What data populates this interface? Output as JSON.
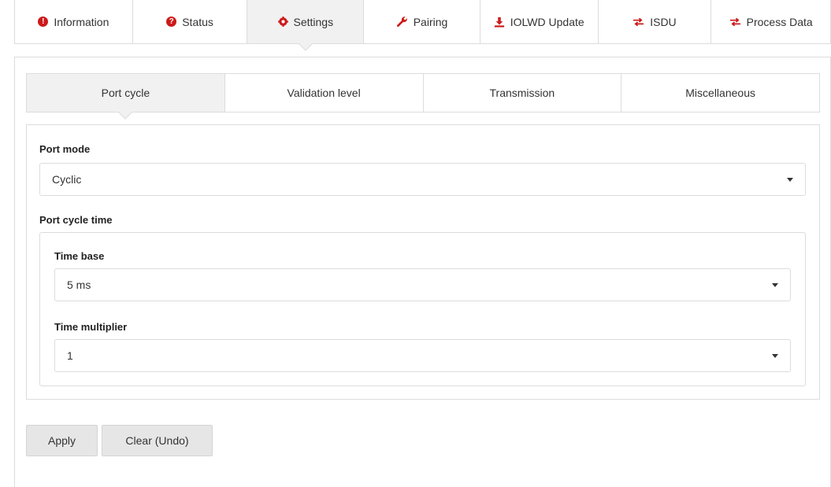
{
  "top_tabs": [
    {
      "label": "Information",
      "icon": "info-icon"
    },
    {
      "label": "Status",
      "icon": "help-icon"
    },
    {
      "label": "Settings",
      "icon": "gear-icon"
    },
    {
      "label": "Pairing",
      "icon": "wrench-icon"
    },
    {
      "label": "IOLWD Update",
      "icon": "download-icon"
    },
    {
      "label": "ISDU",
      "icon": "exchange-icon"
    },
    {
      "label": "Process Data",
      "icon": "exchange-icon"
    }
  ],
  "active_top_tab": "Settings",
  "sub_tabs": [
    {
      "label": "Port cycle"
    },
    {
      "label": "Validation level"
    },
    {
      "label": "Transmission"
    },
    {
      "label": "Miscellaneous"
    }
  ],
  "active_sub_tab": "Port cycle",
  "form": {
    "port_mode_label": "Port mode",
    "port_mode_value": "Cyclic",
    "port_cycle_time_label": "Port cycle time",
    "time_base_label": "Time base",
    "time_base_value": "5 ms",
    "time_multiplier_label": "Time multiplier",
    "time_multiplier_value": "1"
  },
  "buttons": {
    "apply": "Apply",
    "clear": "Clear (Undo)"
  },
  "colors": {
    "accent_red": "#cc1a1a",
    "active_tab_bg": "#f1f1f1",
    "button_bg": "#e6e6e6",
    "border": "#dcdcdc"
  }
}
